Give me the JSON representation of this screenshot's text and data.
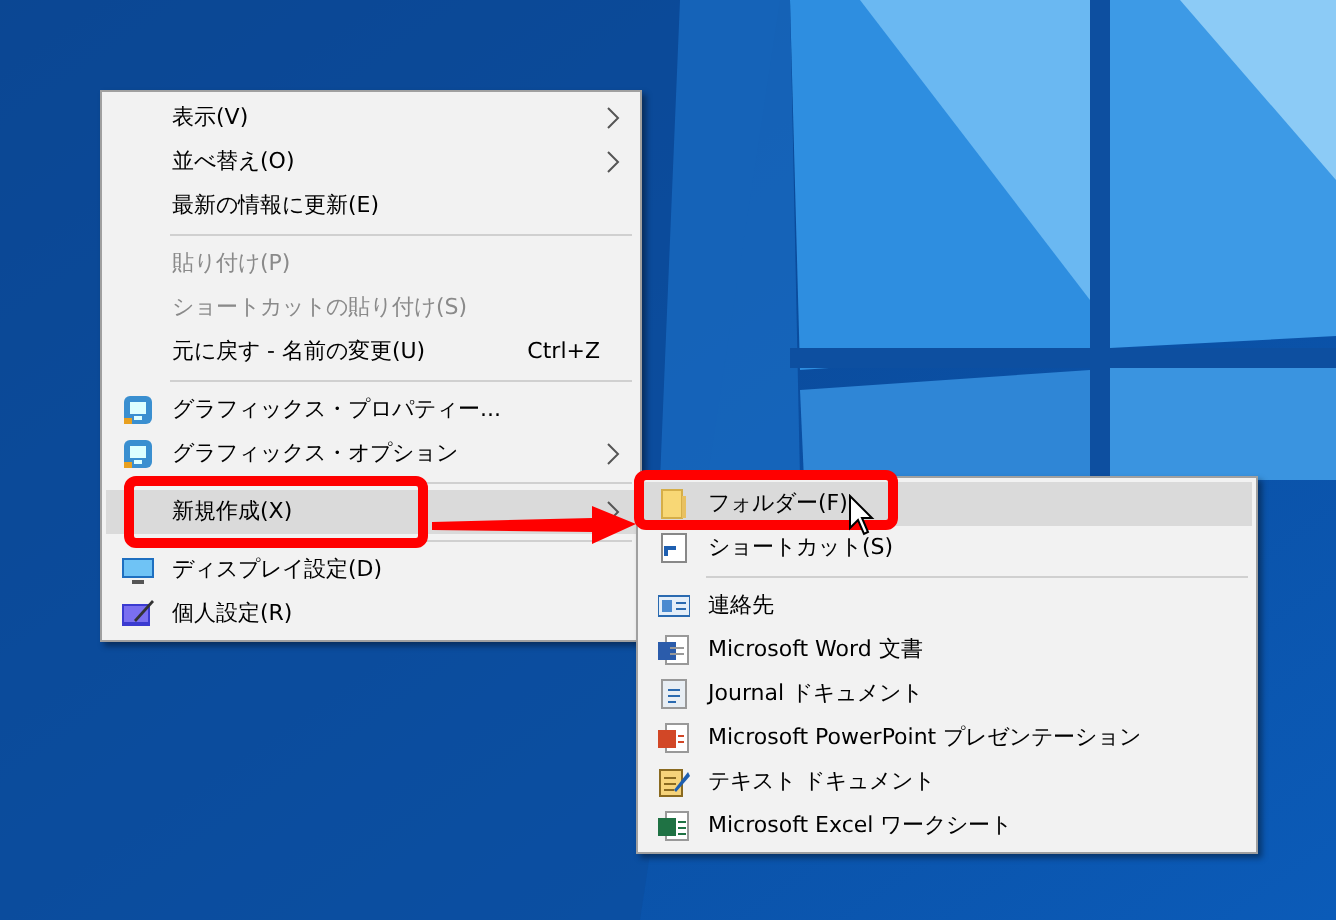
{
  "context_menu": {
    "items": [
      {
        "kind": "item",
        "label": "表示(V)",
        "submenu": true,
        "disabled": false,
        "selected": false
      },
      {
        "kind": "item",
        "label": "並べ替え(O)",
        "submenu": true,
        "disabled": false,
        "selected": false
      },
      {
        "kind": "item",
        "label": "最新の情報に更新(E)",
        "submenu": false,
        "disabled": false,
        "selected": false
      },
      {
        "kind": "separator"
      },
      {
        "kind": "item",
        "label": "貼り付け(P)",
        "submenu": false,
        "disabled": true,
        "selected": false
      },
      {
        "kind": "item",
        "label": "ショートカットの貼り付け(S)",
        "submenu": false,
        "disabled": true,
        "selected": false
      },
      {
        "kind": "item",
        "label": "元に戻す - 名前の変更(U)",
        "shortcut": "Ctrl+Z",
        "submenu": false,
        "disabled": false,
        "selected": false
      },
      {
        "kind": "separator"
      },
      {
        "kind": "item",
        "label": "グラフィックス・プロパティー...",
        "submenu": false,
        "disabled": false,
        "selected": false
      },
      {
        "kind": "item",
        "label": "グラフィックス・オプション",
        "submenu": true,
        "disabled": false,
        "selected": false
      },
      {
        "kind": "separator"
      },
      {
        "kind": "item",
        "label": "新規作成(X)",
        "submenu": true,
        "disabled": false,
        "selected": true
      },
      {
        "kind": "separator"
      },
      {
        "kind": "item",
        "label": "ディスプレイ設定(D)",
        "submenu": false,
        "disabled": false,
        "selected": false
      },
      {
        "kind": "item",
        "label": "個人設定(R)",
        "submenu": false,
        "disabled": false,
        "selected": false
      }
    ]
  },
  "new_submenu": {
    "items": [
      {
        "kind": "item",
        "label": "フォルダー(F)",
        "selected": true
      },
      {
        "kind": "item",
        "label": "ショートカット(S)",
        "selected": false
      },
      {
        "kind": "separator"
      },
      {
        "kind": "item",
        "label": "連絡先",
        "selected": false
      },
      {
        "kind": "item",
        "label": "Microsoft Word 文書",
        "selected": false
      },
      {
        "kind": "item",
        "label": "Journal ドキュメント",
        "selected": false
      },
      {
        "kind": "item",
        "label": "Microsoft PowerPoint プレゼンテーション",
        "selected": false
      },
      {
        "kind": "item",
        "label": "テキスト ドキュメント",
        "selected": false
      },
      {
        "kind": "item",
        "label": "Microsoft Excel ワークシート",
        "selected": false
      }
    ]
  }
}
